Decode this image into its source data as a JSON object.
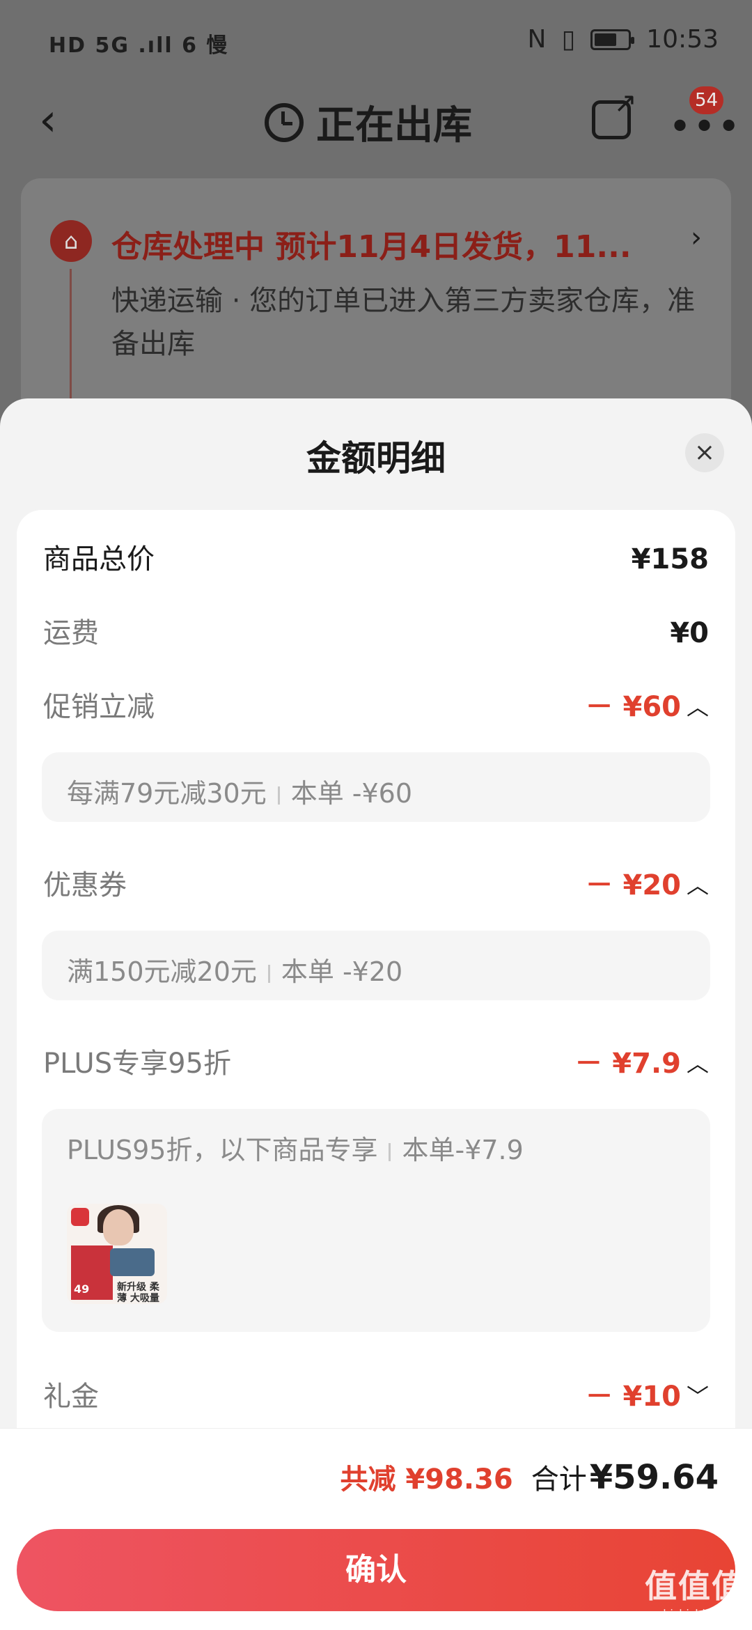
{
  "status_bar": {
    "left": "HD 5G .ıll 6 慢",
    "right_icons": [
      "N",
      "▯"
    ],
    "time": "10:53"
  },
  "nav": {
    "back": "‹",
    "title": "正在出库",
    "more": "•••",
    "badge": "54"
  },
  "order": {
    "status_line": "仓库处理中  预计11月4日发货，11...",
    "description": "快递运输 · 您的订单已进入第三方卖家仓库，准备出库",
    "arrow": "›",
    "warehouse_icon": "⌂"
  },
  "sheet": {
    "title": "金额明细",
    "close": "×",
    "rows": {
      "subtotal": {
        "label": "商品总价",
        "value": "¥158"
      },
      "shipping": {
        "label": "运费",
        "value": "¥0"
      },
      "promo": {
        "label": "促销立减",
        "value": "－ ¥60",
        "detail_left": "每满79元减30元",
        "detail_right": "本单 -¥60"
      },
      "coupon": {
        "label": "优惠券",
        "value": "－ ¥20",
        "detail_left": "满150元减20元",
        "detail_right": "本单 -¥20"
      },
      "plus": {
        "label": "PLUS专享95折",
        "value": "－ ¥7.9",
        "detail_left": "PLUS95折，以下商品专享",
        "detail_right": "本单-¥7.9"
      },
      "gift": {
        "label": "礼金",
        "value": "－ ¥10"
      }
    },
    "product_thumb": {
      "price": "49",
      "tagline": "新升级 柔薄 大吸量"
    },
    "chevrons": {
      "up": "︿",
      "down": "﹀"
    }
  },
  "footer": {
    "saved": "共减 ¥98.36",
    "sum_label": "合计",
    "sum_value": "¥59.64",
    "confirm": "确认"
  },
  "watermark": {
    "big": "值值值",
    "small": "zhizhizhi.com"
  }
}
